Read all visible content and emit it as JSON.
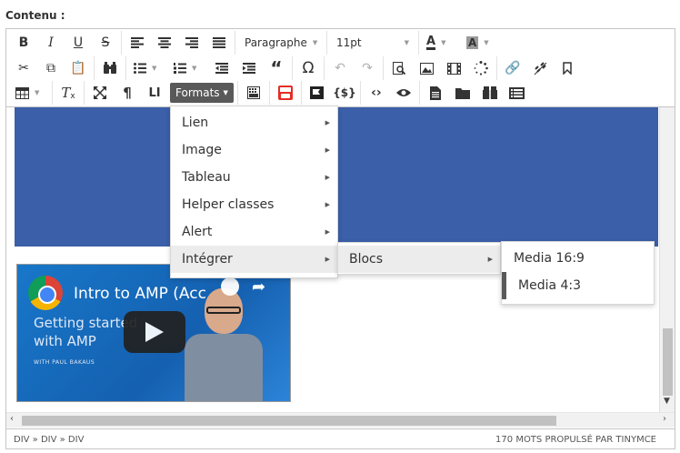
{
  "field_label": "Contenu :",
  "toolbar": {
    "paragraph_select": "Paragraphe",
    "size_select": "11pt",
    "formats_label": "Formats",
    "font_color_glyph": "A",
    "bg_color_glyph": "A",
    "show_blocks_glyph": "LI"
  },
  "menu": {
    "level1": [
      "Lien",
      "Image",
      "Tableau",
      "Helper classes",
      "Alert",
      "Intégrer"
    ],
    "level2": [
      "Blocs"
    ],
    "level3": [
      "Media 16:9",
      "Media 4:3"
    ]
  },
  "video": {
    "title": "Intro to AMP (Acc…",
    "subtitle": "Getting started with AMP",
    "author": "WITH PAUL BAKAUS"
  },
  "statusbar": {
    "path": "DIV » DIV » DIV",
    "wordcount": "170 MOTS PROPULSÉ PAR TINYMCE"
  },
  "colors": {
    "formats_bg": "#595959",
    "image_blue": "#3b5fa8",
    "menu_active": "#ececec"
  }
}
